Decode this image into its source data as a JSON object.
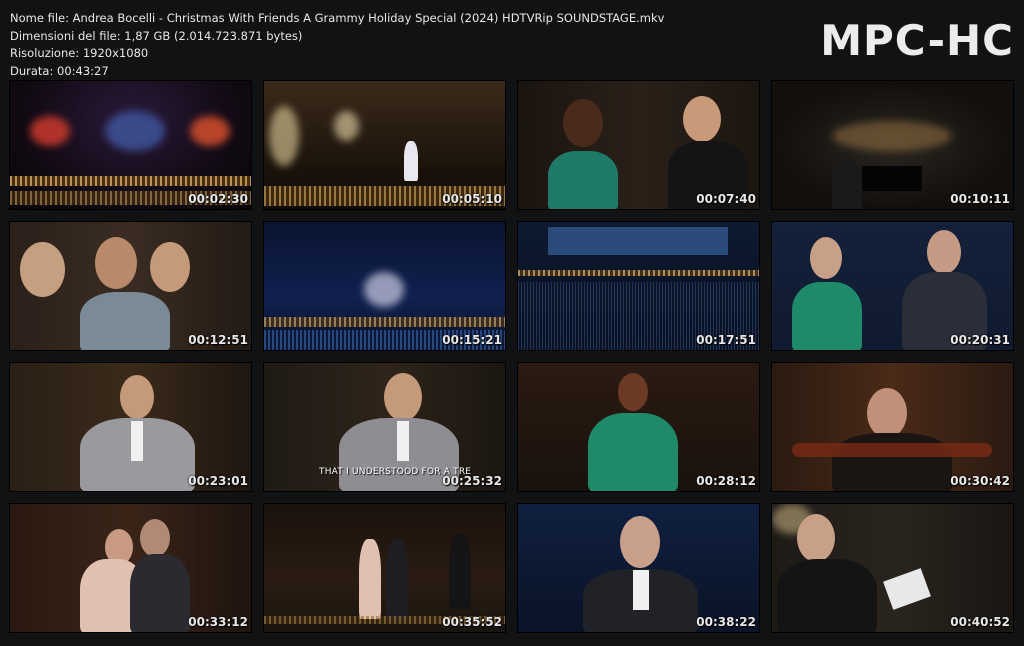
{
  "info": {
    "filename": "Nome file: Andrea Bocelli - Christmas With Friends A Grammy Holiday Special (2024) HDTVRip SOUNDSTAGE.mkv",
    "filesize": "Dimensioni del file: 1,87 GB (2.014.723.871 bytes)",
    "resolution": "Risoluzione: 1920x1080",
    "duration": "Durata: 00:43:27"
  },
  "logo": "MPC-HC",
  "thumbnails": [
    {
      "time": "00:02:30"
    },
    {
      "time": "00:05:10"
    },
    {
      "time": "00:07:40"
    },
    {
      "time": "00:10:11"
    },
    {
      "time": "00:12:51"
    },
    {
      "time": "00:15:21"
    },
    {
      "time": "00:17:51"
    },
    {
      "time": "00:20:31"
    },
    {
      "time": "00:23:01"
    },
    {
      "time": "00:25:32",
      "subtitle": "THAT I UNDERSTOOD FOR A TRE"
    },
    {
      "time": "00:28:12"
    },
    {
      "time": "00:30:42"
    },
    {
      "time": "00:33:12"
    },
    {
      "time": "00:35:52"
    },
    {
      "time": "00:38:22"
    },
    {
      "time": "00:40:52"
    }
  ],
  "colors": {
    "background": "#111214",
    "text": "#e8e8e8"
  }
}
